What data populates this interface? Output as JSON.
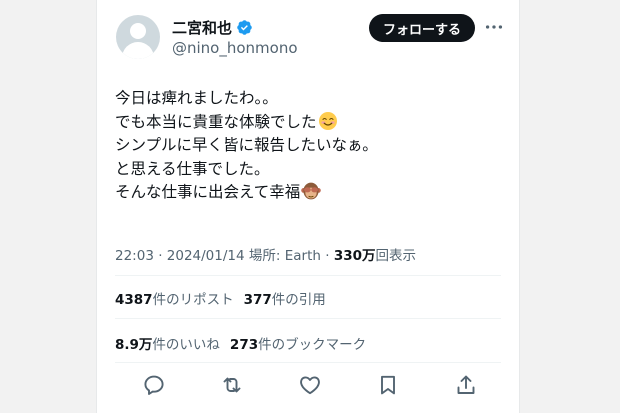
{
  "user": {
    "display_name": "二宮和也",
    "handle": "@nino_honmono",
    "avatar_icon": "default-avatar-icon",
    "verified_icon": "verified-badge-icon",
    "verified_color": "#1d9bf0"
  },
  "header": {
    "follow_label": "フォローする",
    "more_icon": "more-dots-icon"
  },
  "tweet": {
    "lines": [
      "今日は痺れましたわ。。",
      "でも本当に貴重な体験でした",
      "シンプルに早く皆に報告したいなぁ。",
      "と思える仕事でした。",
      "そんな仕事に出会えて幸福"
    ],
    "emoji_line2": "smiling-face-emoji",
    "emoji_line5": "see-no-evil-monkey-emoji"
  },
  "meta": {
    "time": "22:03",
    "sep1": " · ",
    "date": "2024/01/14",
    "location_label": " 場所: ",
    "location": "Earth",
    "sep2": " · ",
    "views_count": "330万",
    "views_label": "回表示"
  },
  "stats": {
    "reposts_count": "4387",
    "reposts_label": "件のリポスト",
    "quotes_count": "377",
    "quotes_label": "件の引用",
    "likes_count": "8.9万",
    "likes_label": "件のいいね",
    "bookmarks_count": "273",
    "bookmarks_label": "件のブックマーク"
  },
  "actions": {
    "reply_icon": "reply-icon",
    "repost_icon": "repost-icon",
    "like_icon": "heart-icon",
    "bookmark_icon": "bookmark-icon",
    "share_icon": "share-icon"
  },
  "colors": {
    "text_primary": "#0f1419",
    "text_secondary": "#536471",
    "button_bg": "#0f1419"
  }
}
